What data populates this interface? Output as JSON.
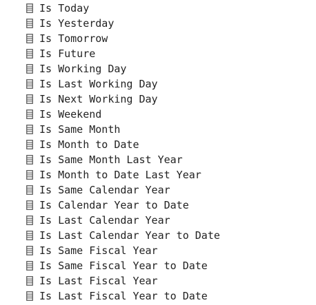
{
  "fields": {
    "icon": "table-column-icon",
    "icon_color": "#5a5a5a",
    "text_color": "#222222",
    "items": [
      {
        "label": "Is Today"
      },
      {
        "label": "Is Yesterday"
      },
      {
        "label": "Is Tomorrow"
      },
      {
        "label": "Is Future"
      },
      {
        "label": "Is Working Day"
      },
      {
        "label": "Is Last Working Day"
      },
      {
        "label": "Is Next Working Day"
      },
      {
        "label": "Is Weekend"
      },
      {
        "label": "Is Same Month"
      },
      {
        "label": "Is Month to Date"
      },
      {
        "label": "Is Same Month Last Year"
      },
      {
        "label": "Is Month to Date Last Year"
      },
      {
        "label": "Is Same Calendar Year"
      },
      {
        "label": "Is Calendar Year to Date"
      },
      {
        "label": "Is Last Calendar Year"
      },
      {
        "label": "Is Last Calendar Year to Date"
      },
      {
        "label": "Is Same Fiscal Year"
      },
      {
        "label": "Is Same Fiscal Year to Date"
      },
      {
        "label": "Is Last Fiscal Year"
      },
      {
        "label": "Is Last Fiscal Year to Date"
      }
    ]
  }
}
